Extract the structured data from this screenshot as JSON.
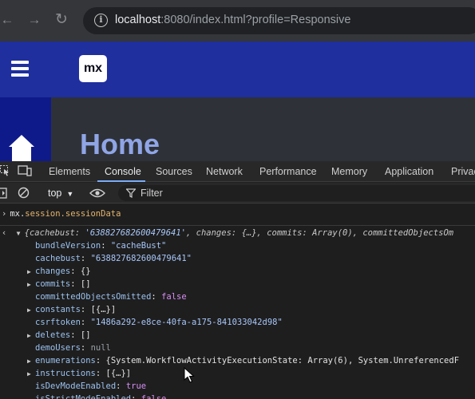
{
  "browser": {
    "url_host": "localhost",
    "url_rest": ":8080/index.html?profile=Responsive"
  },
  "app": {
    "logo_text": "mx",
    "page_title": "Home"
  },
  "devtools": {
    "tabs": [
      "Elements",
      "Console",
      "Sources",
      "Network",
      "Performance",
      "Memory",
      "Application",
      "Privac"
    ],
    "active_tab": "Console",
    "context": "top",
    "filter_placeholder": "Filter"
  },
  "console": {
    "command_obj": "mx.session.sessionData",
    "summary_key1": "cachebust",
    "summary_val1": "'638827682600479641'",
    "summary_key2": "changes",
    "summary_val2": "{…}",
    "summary_key3": "commits",
    "summary_val3": "Array(0)",
    "summary_key4": "committedObjectsOm",
    "properties": [
      {
        "key": "bundleVersion",
        "value": "\"cacheBust\"",
        "kind": "string",
        "expandable": false
      },
      {
        "key": "cachebust",
        "value": "\"638827682600479641\"",
        "kind": "string",
        "expandable": false
      },
      {
        "key": "changes",
        "value": "{}",
        "kind": "plain",
        "expandable": true
      },
      {
        "key": "commits",
        "value": "[]",
        "kind": "plain",
        "expandable": true
      },
      {
        "key": "committedObjectsOmitted",
        "value": "false",
        "kind": "bool",
        "expandable": false
      },
      {
        "key": "constants",
        "value": "[{…}]",
        "kind": "plain",
        "expandable": true
      },
      {
        "key": "csrftoken",
        "value": "\"1486a292-e8ce-40fa-a175-841033042d98\"",
        "kind": "string",
        "expandable": false
      },
      {
        "key": "deletes",
        "value": "[]",
        "kind": "plain",
        "expandable": true
      },
      {
        "key": "demoUsers",
        "value": "null",
        "kind": "null",
        "expandable": false
      },
      {
        "key": "enumerations",
        "value": "{System.WorkflowActivityExecutionState: Array(6), System.UnreferencedF",
        "kind": "plain",
        "expandable": true
      },
      {
        "key": "instructions",
        "value": "[{…}]",
        "kind": "plain",
        "expandable": true
      },
      {
        "key": "isDevModeEnabled",
        "value": "true",
        "kind": "bool",
        "expandable": false
      },
      {
        "key": "isStrictModeEnabled",
        "value": "false",
        "kind": "bool",
        "expandable": false
      }
    ]
  },
  "icons": {
    "back": "arrow-left-icon",
    "forward": "arrow-right-icon",
    "reload": "reload-icon",
    "info": "info-icon",
    "menu": "hamburger-icon",
    "home": "house-icon",
    "inspect": "inspect-element-icon",
    "device": "device-toolbar-icon",
    "sidebar": "console-sidebar-icon",
    "clear": "clear-console-icon",
    "eye": "live-expression-eye-icon",
    "filter": "filter-icon"
  },
  "colors": {
    "header_blue": "#1f2f9e",
    "sidebar_blue": "#0f1a8a",
    "title_blue": "#8fa5e6",
    "active_tab_underline": "#7cacf8"
  }
}
